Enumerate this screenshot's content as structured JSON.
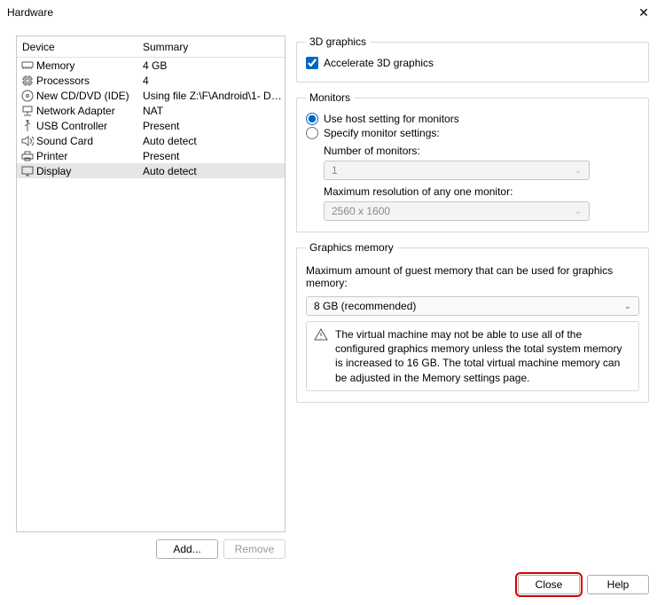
{
  "window": {
    "title": "Hardware"
  },
  "listHeaders": {
    "device": "Device",
    "summary": "Summary"
  },
  "devices": [
    {
      "label": "Memory",
      "summary": "4 GB"
    },
    {
      "label": "Processors",
      "summary": "4"
    },
    {
      "label": "New CD/DVD (IDE)",
      "summary": "Using file Z:\\F\\Android\\1- De..."
    },
    {
      "label": "Network Adapter",
      "summary": "NAT"
    },
    {
      "label": "USB Controller",
      "summary": "Present"
    },
    {
      "label": "Sound Card",
      "summary": "Auto detect"
    },
    {
      "label": "Printer",
      "summary": "Present"
    },
    {
      "label": "Display",
      "summary": "Auto detect"
    }
  ],
  "leftButtons": {
    "add": "Add...",
    "remove": "Remove"
  },
  "threeD": {
    "legend": "3D graphics",
    "checkbox": "Accelerate 3D graphics",
    "checked": true
  },
  "monitors": {
    "legend": "Monitors",
    "radioHost": "Use host setting for monitors",
    "radioSpecify": "Specify monitor settings:",
    "selected": "host",
    "numLabel": "Number of monitors:",
    "numValue": "1",
    "resLabel": "Maximum resolution of any one monitor:",
    "resValue": "2560 x 1600"
  },
  "gmem": {
    "legend": "Graphics memory",
    "desc": "Maximum amount of guest memory that can be used for graphics memory:",
    "value": "8 GB (recommended)",
    "warning": "The virtual machine may not be able to use all of the configured graphics memory unless the total system memory is increased to 16 GB. The total virtual machine memory can be adjusted in the Memory settings page."
  },
  "bottom": {
    "close": "Close",
    "help": "Help"
  }
}
